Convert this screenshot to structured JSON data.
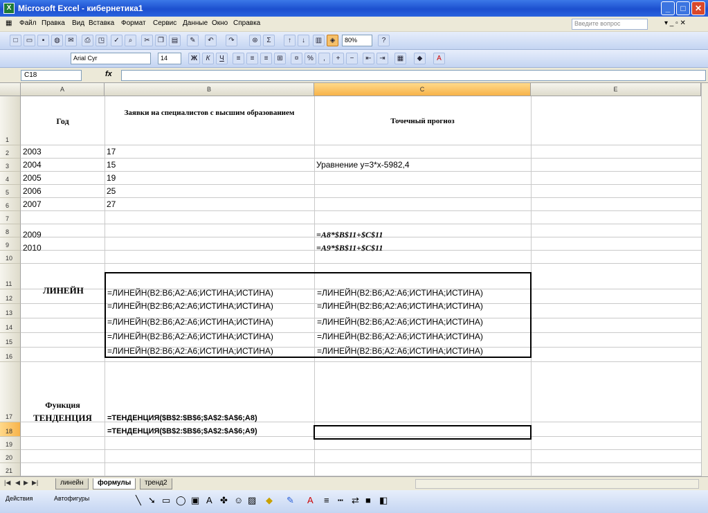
{
  "window": {
    "title": "Microsoft Excel - кибернетика1"
  },
  "menu": {
    "items": [
      "Файл",
      "Правка",
      "Вид",
      "Вставка",
      "Формат",
      "Сервис",
      "Данные",
      "Окно",
      "Справка"
    ],
    "help_placeholder": "Введите вопрос"
  },
  "toolbar": {
    "zoom": "80%",
    "font_name": "Arial Cyr",
    "font_size": "14"
  },
  "formula_bar": {
    "name_box": "C18",
    "fx": "fx",
    "formula": ""
  },
  "columns": [
    "A",
    "B",
    "C",
    "",
    "E"
  ],
  "rows": [
    "1",
    "2",
    "3",
    "4",
    "5",
    "6",
    "7",
    "8",
    "9",
    "10",
    "11",
    "12",
    "13",
    "14",
    "15",
    "16",
    "17",
    "18",
    "19",
    "20",
    "21"
  ],
  "cells": {
    "a1": "Год",
    "b1": "Заявки на специалистов с высшим образованием",
    "c1": "Точечный прогноз",
    "a2": "2003",
    "b2": "17",
    "a3": "2004",
    "b3": "15",
    "c3": "Уравнение  y=3*x-5982,4",
    "a4": "2005",
    "b4": "19",
    "a5": "2006",
    "b5": "25",
    "a6": "2007",
    "b6": "27",
    "a8": "2009",
    "c8": "=A8*$B$11+$C$11",
    "a9": "2010",
    "c9": "=A9*$B$11+$C$11",
    "a11": "ЛИНЕЙН",
    "linest": "=ЛИНЕЙН(B2:B6;A2:A6;ИСТИНА;ИСТИНА)",
    "a17_1": "Функция",
    "a17_2": "ТЕНДЕНЦИЯ",
    "b17": "=ТЕНДЕНЦИЯ($B$2:$B$6;$A$2:$A$6;A8)",
    "b18": "=ТЕНДЕНЦИЯ($B$2:$B$6;$A$2:$A$6;A9)"
  },
  "sheet_tabs": [
    "линейн",
    "формулы",
    "тренд2"
  ],
  "drawing": {
    "actions": "Действия",
    "autoshapes": "Автофигуры"
  }
}
